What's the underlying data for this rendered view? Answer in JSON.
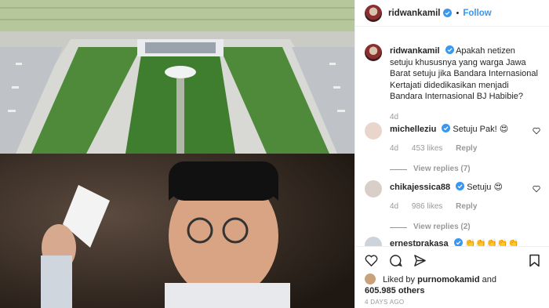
{
  "post": {
    "username": "ridwankamil",
    "follow_label": "Follow",
    "dot": "•"
  },
  "caption": {
    "username": "ridwankamil",
    "text": "Apakah netizen setuju khususnya yang warga Jawa Barat setuju jika Bandara Internasional Kertajati didedikasikan menjadi Bandara Internasional BJ Habibie?",
    "age": "4d"
  },
  "comments": [
    {
      "username": "michelleziu",
      "text": "Setuju Pak! 😍",
      "age": "4d",
      "likes": "453 likes",
      "reply": "Reply",
      "view_replies": "View replies (7)"
    },
    {
      "username": "chikajessica88",
      "text": "Setuju 😍",
      "age": "4d",
      "likes": "986 likes",
      "reply": "Reply",
      "view_replies": "View replies (2)"
    },
    {
      "username": "ernestprakasa",
      "text": "👏👏👏👏👏"
    }
  ],
  "footer": {
    "liked_prefix": "Liked by",
    "liked_user": "purnomokamid",
    "liked_and": "and",
    "liked_count": "605.985 others",
    "timestamp": "4 DAYS AGO"
  },
  "icons": {
    "verified": "verified-badge-icon",
    "heart": "heart-icon",
    "comment": "comment-icon",
    "share": "share-icon",
    "bookmark": "bookmark-icon"
  },
  "colors": {
    "accent": "#3897f0",
    "muted": "#999999",
    "text": "#262626"
  }
}
